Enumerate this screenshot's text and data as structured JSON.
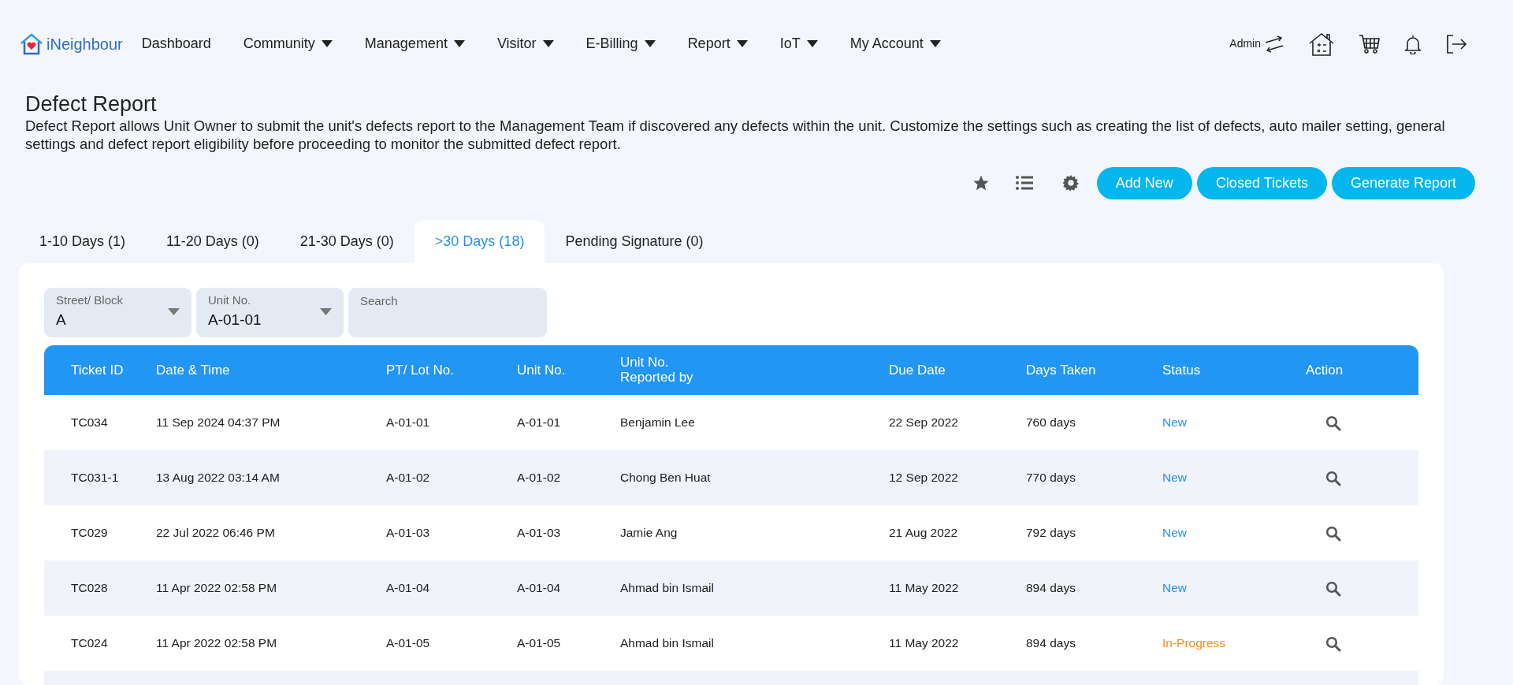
{
  "brand": {
    "name": "iNeighbour"
  },
  "nav": [
    {
      "label": "Dashboard",
      "dropdown": false
    },
    {
      "label": "Community",
      "dropdown": true
    },
    {
      "label": "Management",
      "dropdown": true
    },
    {
      "label": "Visitor",
      "dropdown": true
    },
    {
      "label": "E-Billing",
      "dropdown": true
    },
    {
      "label": "Report",
      "dropdown": true
    },
    {
      "label": "IoT",
      "dropdown": true
    },
    {
      "label": "My Account",
      "dropdown": true
    }
  ],
  "user": {
    "name": "Admin"
  },
  "page": {
    "title": "Defect Report",
    "description": "Defect Report allows Unit Owner to submit the unit's defects report to the Management Team if discovered any defects within the unit. Customize the settings such as creating the list of defects, auto mailer setting, general settings and defect report eligibility before proceeding to monitor the submitted defect report."
  },
  "actions": [
    "Add New",
    "Closed Tickets",
    "Generate Report"
  ],
  "tabs": [
    {
      "label": "1-10 Days (1)",
      "selected": false
    },
    {
      "label": "11-20 Days (0)",
      "selected": false
    },
    {
      "label": "21-30 Days (0)",
      "selected": false
    },
    {
      "label": ">30 Days (18)",
      "selected": true
    },
    {
      "label": "Pending Signature (0)",
      "selected": false
    }
  ],
  "filters": [
    {
      "kind": "select",
      "label": "Street/ Block",
      "value": "A"
    },
    {
      "kind": "select",
      "label": "Unit No.",
      "value": "A-01-01"
    },
    {
      "kind": "search",
      "placeholder": "Search"
    }
  ],
  "table": {
    "columns": [
      "Ticket ID",
      "Date & Time",
      "PT/ Lot No.",
      "Unit No.",
      [
        "Unit No.",
        "Reported by"
      ],
      "Due Date",
      "Days Taken",
      "Status",
      "Action"
    ],
    "rows": [
      {
        "ticket_id": "TC034",
        "date_time": "11 Sep 2024 04:37 PM",
        "lot_no": "A-01-01",
        "unit_no": "A-01-01",
        "reported_by": "Benjamin Lee",
        "due_date": "22 Sep 2022",
        "days_taken": "760 days",
        "status": {
          "text": "New",
          "kind": "new"
        }
      },
      {
        "ticket_id": "TC031-1",
        "date_time": "13 Aug 2022 03:14 AM",
        "lot_no": "A-01-02",
        "unit_no": "A-01-02",
        "reported_by": "Chong Ben Huat",
        "due_date": "12 Sep 2022",
        "days_taken": "770 days",
        "status": {
          "text": "New",
          "kind": "new"
        }
      },
      {
        "ticket_id": "TC029",
        "date_time": "22 Jul 2022 06:46 PM",
        "lot_no": "A-01-03",
        "unit_no": "A-01-03",
        "reported_by": "Jamie Ang",
        "due_date": "21 Aug 2022",
        "days_taken": "792 days",
        "status": {
          "text": "New",
          "kind": "new"
        }
      },
      {
        "ticket_id": "TC028",
        "date_time": "11 Apr 2022 02:58 PM",
        "lot_no": "A-01-04",
        "unit_no": "A-01-04",
        "reported_by": "Ahmad bin Ismail",
        "due_date": "11 May 2022",
        "days_taken": "894 days",
        "status": {
          "text": "New",
          "kind": "new"
        }
      },
      {
        "ticket_id": "TC024",
        "date_time": "11 Apr 2022 02:58 PM",
        "lot_no": "A-01-05",
        "unit_no": "A-01-05",
        "reported_by": "Ahmad bin Ismail",
        "due_date": "11 May 2022",
        "days_taken": "894 days",
        "status": {
          "text": "In-Progress",
          "kind": "in_progress"
        }
      }
    ]
  }
}
